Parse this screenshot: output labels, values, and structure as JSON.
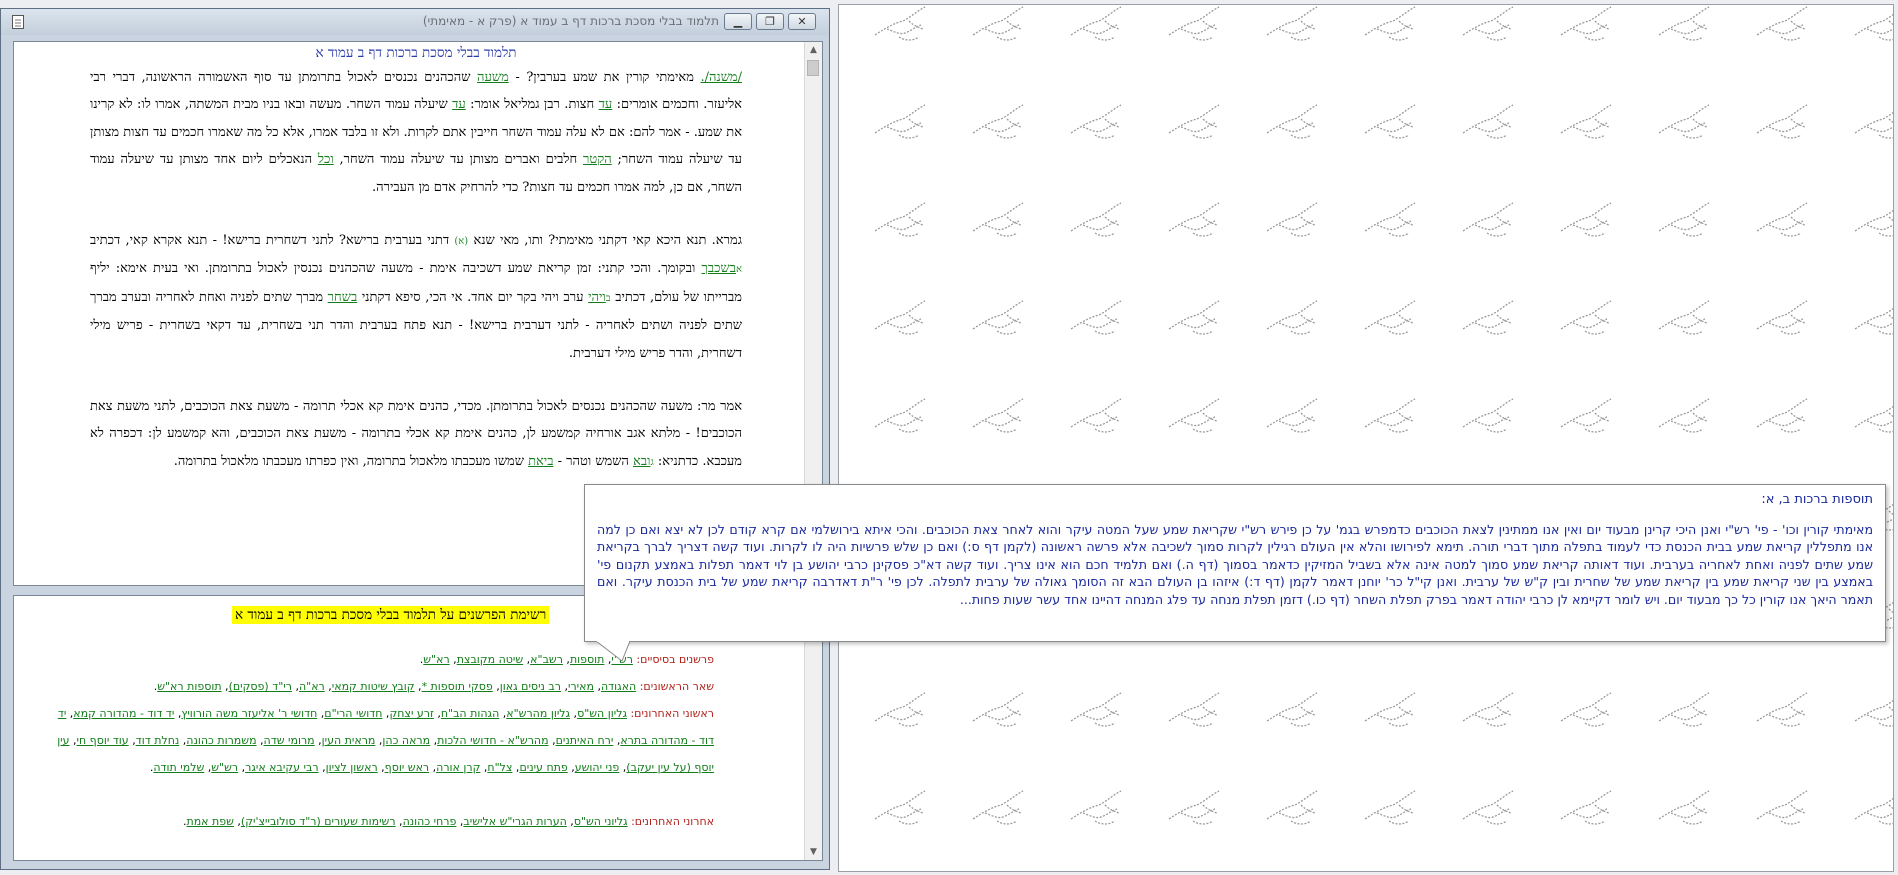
{
  "window": {
    "title": "תלמוד בבלי מסכת ברכות דף ב עמוד א (פרק א - מאימתי)"
  },
  "main": {
    "heading": "תלמוד בבלי מסכת ברכות דף ב עמוד א",
    "mishna": [
      {
        "t": "/משנה/.",
        "link": true
      },
      {
        "t": " מאימתי קורין את שמע בערבין? - "
      },
      {
        "t": "משעה",
        "link": true
      },
      {
        "t": " שהכהנים נכנסים לאכול בתרומתן עד סוף האשמורה הראשונה, דברי רבי אליעזר. וחכמים אומרים: "
      },
      {
        "t": "עד",
        "link": true
      },
      {
        "t": " חצות. רבן גמליאל אומר: "
      },
      {
        "t": "עד",
        "link": true
      },
      {
        "t": " שיעלה עמוד השחר. מעשה ובאו בניו מבית המשתה, אמרו לו: לא קרינו את שמע. - אמר להם: אם לא עלה עמוד השחר חייבין אתם לקרות. ולא זו בלבד אמרו, אלא כל מה שאמרו חכמים עד חצות מצותן עד שיעלה עמוד השחר; "
      },
      {
        "t": "הקטר",
        "link": true
      },
      {
        "t": " חלבים ואברים מצותן עד שיעלה עמוד השחר, "
      },
      {
        "t": "וכל",
        "link": true
      },
      {
        "t": " הנאכלים ליום אחד מצותן עד שיעלה עמוד השחר, אם כן, למה אמרו חכמים עד חצות? כדי להרחיק אדם מן העבירה."
      }
    ],
    "gemara": [
      {
        "t": "גמרא. תנא היכא קאי דקתני מאימתי? ותו, מאי שנא "
      },
      {
        "t": "(א)",
        "fn": true
      },
      {
        "t": " דתני בערבית ברישא? לתני דשחרית ברישא! - תנא אקרא קאי, דכתיב "
      },
      {
        "t": "א",
        "fn": true
      },
      {
        "t": "בשכבך",
        "link": true
      },
      {
        "t": " ובקומך. והכי קתני: זמן קריאת שמע דשכיבה אימת - משעה שהכהנים נכנסין לאכול בתרומתן. ואי בעית אימא: יליף מברייתו של עולם, דכתיב "
      },
      {
        "t": "ב",
        "fn": true
      },
      {
        "t": "ויהי",
        "link": true
      },
      {
        "t": " ערב ויהי בקר יום אחד. אי הכי, סיפא דקתני "
      },
      {
        "t": "בשחר",
        "link": true
      },
      {
        "t": " מברך שתים לפניה ואחת לאחריה ובערב מברך שתים לפניה ושתים לאחריה - לתני דערבית ברישא! - תנא פתח בערבית והדר תני בשחרית, עד דקאי בשחרית - פריש מילי דשחרית, והדר פריש מילי דערבית."
      }
    ],
    "amar": [
      {
        "t": "אמר מר: משעה שהכהנים נכנסים לאכול בתרומתן. מכדי, כהנים אימת קא אכלי תרומה - משעת צאת הכוכבים, לתני משעת צאת הכוכבים! - מלתא אגב אורחיה קמשמע לן, כהנים אימת קא אכלי בתרומה - משעת צאת הכוכבים, והא קמשמע לן: דכפרה לא מעכבא. כדתניא: "
      },
      {
        "t": "ג",
        "fn": true
      },
      {
        "t": "ובא",
        "link": true
      },
      {
        "t": " השמש וטהר - "
      },
      {
        "t": "ביאת",
        "link": true
      },
      {
        "t": " שמשו מעכבתו מלאכול בתרומה, ואין כפרתו מעכבתו מלאכול בתרומה."
      }
    ]
  },
  "commentators": {
    "title": "רשימת הפרשנים על תלמוד בבלי מסכת ברכות דף ב עמוד א",
    "rows": [
      {
        "label": "פרשנים בסיסיים:",
        "items": [
          "רש\"י",
          "תוספות",
          "רשב\"א",
          "שיטה מקובצת",
          "רא\"ש"
        ]
      },
      {
        "label": "שאר הראשונים:",
        "items": [
          "האגודה",
          "מאירי",
          "רב ניסים גאון",
          "פסקי תוספות *",
          "קובץ שיטות קמאי",
          "רא\"ה",
          "רי\"ד (פסקים)",
          "תוספות רא\"ש"
        ]
      },
      {
        "label": "ראשוני האחרונים:",
        "items": [
          "גליון הש\"ס",
          "גליון מהרש\"א",
          "הגהות הב\"ח",
          "זרע יצחק",
          "חדושי הרי\"ם",
          "חדושי ר' אליעזר משה הורוויץ",
          "יד דוד - מהדורה קמא",
          "יד דוד - מהדורה בתרא",
          "ירח האיתנים",
          "מהרש\"א - חדושי הלכות",
          "מראה כהן",
          "מראית העין",
          "מרומי שדה",
          "משמרות כהונה",
          "נחלת דוד",
          "עוד יוסף חי",
          "עין יוסף (על עין יעקב)",
          "פני יהושע",
          "פתח עינים",
          "צל\"ח",
          "קרן אורה",
          "ראש יוסף",
          "ראשון לציון",
          "רבי עקיבא איגר",
          "רש\"ש",
          "שלמי תודה"
        ]
      },
      {
        "label": "אחרוני האחרונים:",
        "items": [
          "גליוני הש\"ס",
          "הערות הגרי\"ש אלישיב",
          "פרחי כהונה",
          "רשימות שעורים (ר\"ד סולובייצ'יק)",
          "שפת אמת"
        ]
      }
    ]
  },
  "popup": {
    "title": "תוספות ברכות ב, א:",
    "body": "מאימתי קורין וכו' - פי' רש\"י ואנן היכי קרינן מבעוד יום ואין אנו ממתינין לצאת הכוכבים כדמפרש בגמ' על כן פירש רש\"י שקריאת שמע שעל המטה עיקר והוא לאחר צאת הכוכבים. והכי איתא בירושלמי אם קרא קודם לכן לא יצא ואם כן למה אנו מתפללין קריאת שמע בבית הכנסת כדי לעמוד בתפלה מתוך דברי תורה. תימא לפירושו והלא אין העולם רגילין לקרות סמוך לשכיבה אלא פרשה ראשונה (לקמן דף ס:) ואם כן שלש פרשיות היה לו לקרות. ועוד קשה דצריך לברך בקריאת שמע שתים לפניה ואחת לאחריה בערבית. ועוד דאותה קריאת שמע סמוך למטה אינה אלא בשביל המזיקין כדאמר בסמוך (דף ה.) ואם תלמיד חכם הוא אינו צריך. ועוד קשה דא\"כ פסקינן כרבי יהושע בן לוי דאמר תפלות באמצע תקנום פי' באמצע בין שני קריאת שמע בין קריאת שמע של שחרית ובין ק\"ש של ערבית. ואנן קי\"ל כר' יוחנן דאמר לקמן (דף ד:) איזהו בן העולם הבא זה הסומך גאולה של ערבית לתפלה. לכן פי' ר\"ת דאדרבה קריאת שמע של בית הכנסת עיקר. ואם תאמר היאך אנו קורין כל כך מבעוד יום. ויש לומר דקיימא לן כרבי יהודה דאמר בפרק תפלת השחר (דף כו.) דזמן תפלת מנחה עד פלג המנחה דהיינו אחד עשר שעות פחות..."
  }
}
